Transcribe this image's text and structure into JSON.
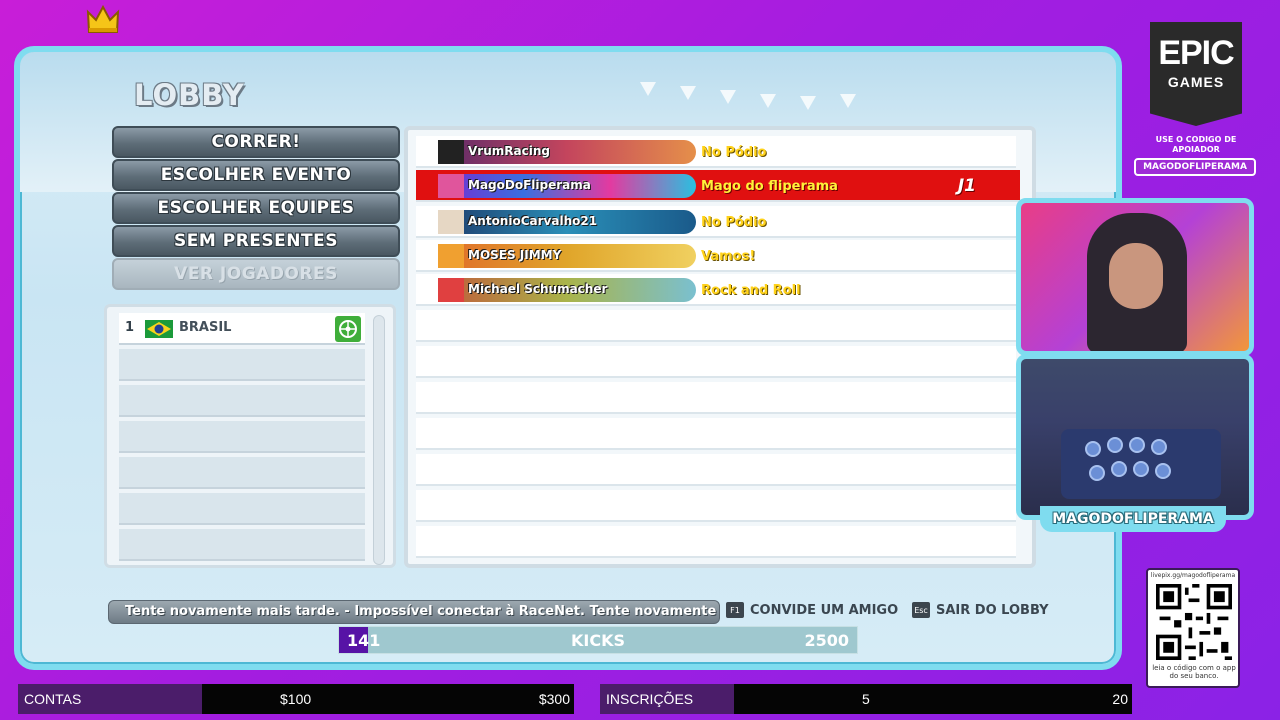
{
  "game": {
    "title": "LOBBY",
    "menu": [
      {
        "label": "CORRER!"
      },
      {
        "label": "ESCOLHER EVENTO"
      },
      {
        "label": "ESCOLHER EQUIPES"
      },
      {
        "label": "SEM PRESENTES"
      },
      {
        "label": "VER JOGADORES"
      }
    ],
    "team": {
      "rank": "1",
      "name": "BRASIL",
      "flag_icon": "brazil-flag-icon"
    },
    "players": [
      {
        "name": "VrumRacing",
        "tagline": "No Pódio",
        "badge": "",
        "active": false,
        "banner_color": "#c4455d"
      },
      {
        "name": "MagoDoFliperama",
        "tagline": "Mago do fliperama",
        "badge": "J1",
        "active": true,
        "banner_color": "#3a6fe0"
      },
      {
        "name": "AntonioCarvalho21",
        "tagline": "No Pódio",
        "badge": "",
        "active": false,
        "banner_color": "#2a8fb8"
      },
      {
        "name": "MOSES JIMMY",
        "tagline": "Vamos!",
        "badge": "",
        "active": false,
        "banner_color": "#e0a52a"
      },
      {
        "name": "Michael Schumacher",
        "tagline": "Rock and Roll",
        "badge": "",
        "active": false,
        "banner_color": "#a9b44a"
      }
    ],
    "ticker": "Tente novamente mais tarde.  -  Impossível conectar à RaceNet. Tente novamente",
    "hints": [
      {
        "key": "F1",
        "label": "CONVIDE UM AMIGO"
      },
      {
        "key": "Esc",
        "label": "SAIR DO LOBBY"
      }
    ],
    "kicks": {
      "current": "141",
      "label": "KICKS",
      "goal": "2500",
      "progress": 0.056
    }
  },
  "sidebar": {
    "epic_top": "EPIC",
    "epic_bottom": "GAMES",
    "support_text": "USE O CODIGO DE APOIADOR",
    "support_code": "MAGODOFLIPERAMA",
    "streamer_name": "MAGODOFLIPERAMA",
    "qr_url": "livepix.gg/magodofliperama",
    "qr_caption": "leia o código com o app do seu banco."
  },
  "goals": [
    {
      "label": "CONTAS",
      "mid": "$100",
      "end": "$300",
      "progress": 0.0
    },
    {
      "label": "INSCRIÇÕES",
      "mid": "5",
      "end": "20",
      "progress": 0.0
    }
  ],
  "colors": {
    "frame": "#7fdcef",
    "background": "#b41fde",
    "active_row": "#e01010",
    "kicks_fill": "#5713a6"
  }
}
